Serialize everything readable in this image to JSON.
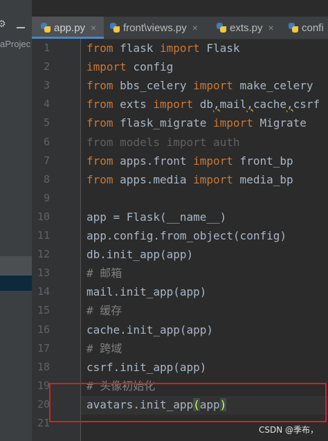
{
  "project": {
    "label": "aProjec"
  },
  "tabs": [
    {
      "label": "app.py",
      "close": "×",
      "active": true
    },
    {
      "label": "front\\views.py",
      "close": "×",
      "active": false
    },
    {
      "label": "exts.py",
      "close": "×",
      "active": false
    },
    {
      "label": "confi",
      "close": "",
      "active": false
    }
  ],
  "editor": {
    "lines": [
      {
        "n": "1",
        "tokens": [
          {
            "t": "from",
            "c": "kw"
          },
          {
            "t": " flask "
          },
          {
            "t": "import",
            "c": "kw"
          },
          {
            "t": " Flask"
          }
        ]
      },
      {
        "n": "2",
        "tokens": [
          {
            "t": "import",
            "c": "kw"
          },
          {
            "t": " config"
          }
        ]
      },
      {
        "n": "3",
        "tokens": [
          {
            "t": "from",
            "c": "kw"
          },
          {
            "t": " bbs_celery "
          },
          {
            "t": "import",
            "c": "kw"
          },
          {
            "t": " make_celery"
          }
        ]
      },
      {
        "n": "4",
        "tokens": [
          {
            "t": "from",
            "c": "kw"
          },
          {
            "t": " exts "
          },
          {
            "t": "import",
            "c": "kw"
          },
          {
            "t": " db"
          },
          {
            "t": ",",
            "c": "under"
          },
          {
            "t": "mail"
          },
          {
            "t": ",",
            "c": "under"
          },
          {
            "t": "cache"
          },
          {
            "t": ",",
            "c": "under"
          },
          {
            "t": "csrf"
          }
        ]
      },
      {
        "n": "5",
        "tokens": [
          {
            "t": "from",
            "c": "kw"
          },
          {
            "t": " flask_migrate "
          },
          {
            "t": "import",
            "c": "kw"
          },
          {
            "t": " Migrate"
          }
        ]
      },
      {
        "n": "6",
        "tokens": [
          {
            "t": "from models import auth",
            "c": "dim"
          }
        ]
      },
      {
        "n": "7",
        "tokens": [
          {
            "t": "from",
            "c": "kw"
          },
          {
            "t": " apps.front "
          },
          {
            "t": "import",
            "c": "kw"
          },
          {
            "t": " front_bp"
          }
        ]
      },
      {
        "n": "8",
        "tokens": [
          {
            "t": "from",
            "c": "kw"
          },
          {
            "t": " apps.media "
          },
          {
            "t": "import",
            "c": "kw"
          },
          {
            "t": " media_bp"
          }
        ]
      },
      {
        "n": "9",
        "tokens": []
      },
      {
        "n": "10",
        "tokens": [
          {
            "t": "app = Flask(__name__)"
          }
        ]
      },
      {
        "n": "11",
        "tokens": [
          {
            "t": "app.config.from_object(config)"
          }
        ]
      },
      {
        "n": "12",
        "tokens": [
          {
            "t": "db.init_app(app)"
          }
        ]
      },
      {
        "n": "13",
        "tokens": [
          {
            "t": "# 邮箱",
            "c": "cm"
          }
        ]
      },
      {
        "n": "14",
        "tokens": [
          {
            "t": "mail.init_app(app)"
          }
        ]
      },
      {
        "n": "15",
        "tokens": [
          {
            "t": "# 缓存",
            "c": "cm"
          }
        ]
      },
      {
        "n": "16",
        "tokens": [
          {
            "t": "cache.init_app(app)"
          }
        ]
      },
      {
        "n": "17",
        "tokens": [
          {
            "t": "# 跨域",
            "c": "cm"
          }
        ]
      },
      {
        "n": "18",
        "tokens": [
          {
            "t": "csrf.init_app(app)"
          }
        ]
      },
      {
        "n": "19",
        "tokens": [
          {
            "t": "# 头像初始化",
            "c": "cm"
          }
        ]
      },
      {
        "n": "20",
        "tokens": [
          {
            "t": "avatars.init_app"
          },
          {
            "t": "(",
            "c": "paren-hl"
          },
          {
            "t": "app"
          },
          {
            "t": ")",
            "c": "paren-hl"
          }
        ]
      },
      {
        "n": "21",
        "tokens": []
      }
    ]
  },
  "watermark": "CSDN @季布，",
  "colors": {
    "keyword": "#cc7832",
    "comment": "#808080",
    "text": "#a9b7c6",
    "error_box": "#d82020"
  }
}
